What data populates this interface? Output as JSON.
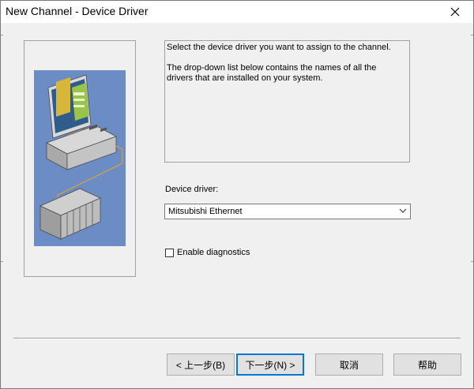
{
  "window": {
    "title": "New Channel - Device Driver",
    "close_icon": "close-icon"
  },
  "info": {
    "line1": "Select the device driver you want to assign to the channel.",
    "line2": "The drop-down list below contains the names of all the drivers that are installed on your system."
  },
  "driver": {
    "label": "Device driver:",
    "selected": "Mitsubishi Ethernet"
  },
  "diagnostics": {
    "label": "Enable diagnostics",
    "checked": false
  },
  "buttons": {
    "back": "< 上一步(B)",
    "next": "下一步(N) >",
    "cancel": "取消",
    "help": "帮助"
  },
  "colors": {
    "panel_blue": "#6b8cc5",
    "accent_border": "#0078d7",
    "screen_green": "#9ac34a"
  }
}
